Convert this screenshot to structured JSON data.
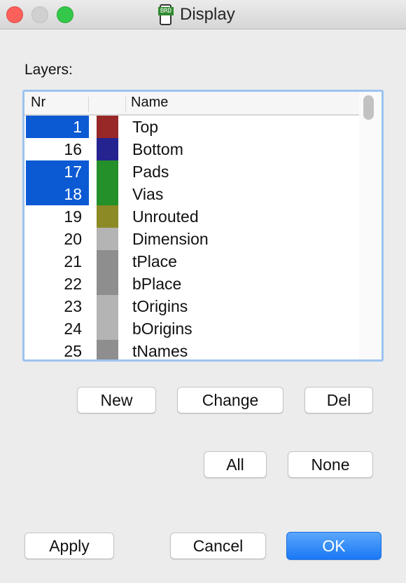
{
  "window": {
    "title": "Display",
    "app_icon": "brd-document-icon",
    "app_icon_badge": "BRD"
  },
  "layers": {
    "label": "Layers:",
    "columns": [
      "Nr",
      "",
      "Name"
    ],
    "rows": [
      {
        "nr": "1",
        "name": "Top",
        "color": "#982828",
        "selected": true
      },
      {
        "nr": "16",
        "name": "Bottom",
        "color": "#25238f",
        "selected": false
      },
      {
        "nr": "17",
        "name": "Pads",
        "color": "#23902a",
        "selected": true
      },
      {
        "nr": "18",
        "name": "Vias",
        "color": "#23902a",
        "selected": true
      },
      {
        "nr": "19",
        "name": "Unrouted",
        "color": "#8c8a24",
        "selected": false
      },
      {
        "nr": "20",
        "name": "Dimension",
        "color": "#b4b4b4",
        "selected": false
      },
      {
        "nr": "21",
        "name": "tPlace",
        "color": "#8e8e8e",
        "selected": false
      },
      {
        "nr": "22",
        "name": "bPlace",
        "color": "#8e8e8e",
        "selected": false
      },
      {
        "nr": "23",
        "name": "tOrigins",
        "color": "#b4b4b4",
        "selected": false
      },
      {
        "nr": "24",
        "name": "bOrigins",
        "color": "#b4b4b4",
        "selected": false
      },
      {
        "nr": "25",
        "name": "tNames",
        "color": "#8e8e8e",
        "selected": false
      }
    ]
  },
  "buttons": {
    "new": "New",
    "change": "Change",
    "del": "Del",
    "all": "All",
    "none": "None",
    "apply": "Apply",
    "cancel": "Cancel",
    "ok": "OK"
  },
  "colors": {
    "selection": "#0b5ad4",
    "primary_button": "#1a78f5",
    "focus_ring": "#9cc3f0"
  }
}
